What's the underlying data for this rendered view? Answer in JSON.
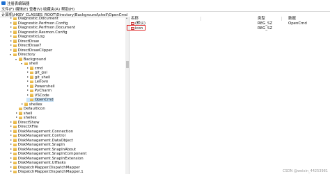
{
  "window": {
    "title": "注册表编辑器"
  },
  "menu": [
    "文件(F)",
    "编辑(E)",
    "查看(V)",
    "收藏夹(A)",
    "帮助(H)"
  ],
  "address": "计算机\\HKEY_CLASSES_ROOT\\Directory\\Background\\shell\\OpenCmd",
  "tree": [
    {
      "label": "Diagnostic.Document",
      "expander": "right"
    },
    {
      "label": "Diagnostic.Perfmon.Config",
      "expander": "right"
    },
    {
      "label": "Diagnostic.Perfmon.Document",
      "expander": "right"
    },
    {
      "label": "Diagnostic.Resmon.Config",
      "expander": "right"
    },
    {
      "label": "DiagnosticLog",
      "expander": "right"
    },
    {
      "label": "DirectDraw",
      "expander": "right"
    },
    {
      "label": "DirectDraw7",
      "expander": "right"
    },
    {
      "label": "DirectDrawClipper",
      "expander": "right"
    },
    {
      "label": "Directory",
      "expander": "down"
    },
    {
      "label": "Background",
      "expander": "down"
    },
    {
      "label": "shell",
      "expander": "down"
    },
    {
      "label": "cmd",
      "expander": "right"
    },
    {
      "label": "git_gui",
      "expander": "right"
    },
    {
      "label": "git_shell",
      "expander": "right"
    },
    {
      "label": "Lenovo",
      "expander": "right"
    },
    {
      "label": "Powershell",
      "expander": "right"
    },
    {
      "label": "PyCharm",
      "expander": "right"
    },
    {
      "label": "VSCode",
      "expander": "right"
    },
    {
      "label": "OpenCmd",
      "expander": "none",
      "selected": true
    },
    {
      "label": "shellex",
      "expander": "right"
    },
    {
      "label": "DefaultIcon",
      "expander": "none"
    },
    {
      "label": "shell",
      "expander": "right"
    },
    {
      "label": "shellex",
      "expander": "right"
    },
    {
      "label": "DirectShow",
      "expander": "right"
    },
    {
      "label": "DirectXFile",
      "expander": "right"
    },
    {
      "label": "DiskManagement.Connection",
      "expander": "right"
    },
    {
      "label": "DiskManagement.Control",
      "expander": "right"
    },
    {
      "label": "DiskManagement.DataObject",
      "expander": "right"
    },
    {
      "label": "DiskManagement.SnapIn",
      "expander": "right"
    },
    {
      "label": "DiskManagement.SnapInAbout",
      "expander": "right"
    },
    {
      "label": "DiskManagement.SnapInComponent",
      "expander": "right"
    },
    {
      "label": "DiskManagement.SnapInExtension",
      "expander": "right"
    },
    {
      "label": "DiskManagement.UITasks",
      "expander": "right"
    },
    {
      "label": "DispatchMapper.DispatchMapper",
      "expander": "right"
    },
    {
      "label": "DispatchMapper.DispatchMapper.1",
      "expander": "right"
    }
  ],
  "list": {
    "headers": [
      "名称",
      "类型",
      "数据"
    ],
    "rows": [
      {
        "icon": "ab",
        "name": "(默认)",
        "type": "REG_SZ",
        "data": "OpenCmd"
      },
      {
        "icon": "ab",
        "name": "icon",
        "type": "REG_SZ",
        "data": ""
      }
    ]
  },
  "watermark": "CSDN @weixin_44253981"
}
